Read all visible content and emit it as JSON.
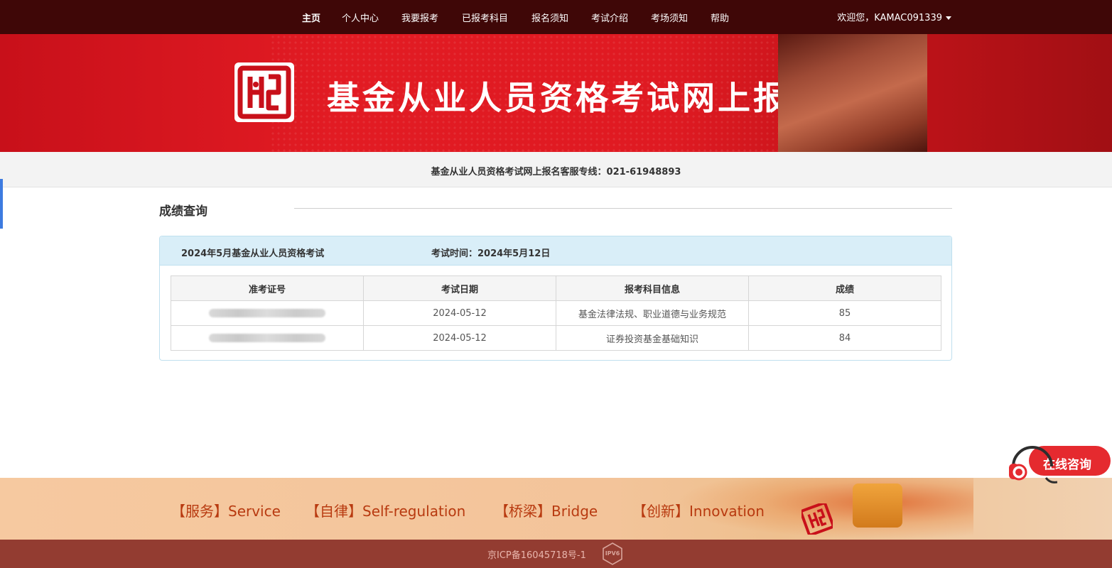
{
  "nav": {
    "items": [
      {
        "label": "主页",
        "active": true
      },
      {
        "label": "个人中心",
        "active": false
      },
      {
        "label": "我要报考",
        "active": false
      },
      {
        "label": "已报考科目",
        "active": false
      },
      {
        "label": "报名须知",
        "active": false
      },
      {
        "label": "考试介绍",
        "active": false
      },
      {
        "label": "考场须知",
        "active": false
      },
      {
        "label": "帮助",
        "active": false
      }
    ],
    "user": "欢迎您，KAMAC091339"
  },
  "banner": {
    "title": "基金从业人员资格考试网上报名",
    "logo_icon": "amac-seal-logo"
  },
  "hotline": "基金从业人员资格考试网上报名客服专线：021-61948893",
  "section": {
    "title": "成绩查询"
  },
  "exam": {
    "name": "2024年5月基金从业人员资格考试",
    "time": "考试时间：2024年5月12日"
  },
  "table": {
    "headers": [
      "准考证号",
      "考试日期",
      "报考科目信息",
      "成绩"
    ],
    "rows": [
      {
        "ticket": "",
        "date": "2024-05-12",
        "subject": "基金法律法规、职业道德与业务规范",
        "score": "85"
      },
      {
        "ticket": "",
        "date": "2024-05-12",
        "subject": "证券投资基金基础知识",
        "score": "84"
      }
    ]
  },
  "footer": {
    "slogans": [
      "【服务】Service",
      "【自律】Self-regulation",
      "【桥梁】Bridge",
      "【创新】Innovation"
    ],
    "icp": "京ICP备16045718号-1",
    "ipv6_badge": "IPV6"
  },
  "consult": {
    "label": "在线咨询",
    "icon": "headset-icon"
  },
  "colors": {
    "nav_bg": "#3f0707",
    "banner_red": "#e21b23",
    "panel_head": "#d9eef8",
    "footer_bg": "#933c31",
    "slogan_text": "#b83a10",
    "consult_red": "#e52a2f"
  }
}
